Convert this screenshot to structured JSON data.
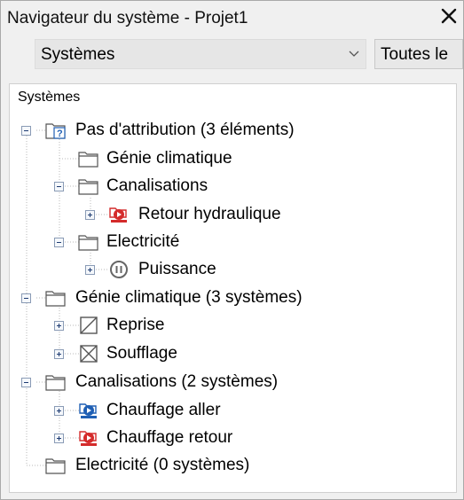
{
  "window": {
    "title": "Navigateur du système - Projet1"
  },
  "toolbar": {
    "view_select_value": "Systèmes",
    "all_button_label": "Toutes le"
  },
  "panel": {
    "header": "Systèmes",
    "rows": [
      {
        "label": "Pas d'attribution (3 éléments)",
        "icon": "unassigned-folder-icon"
      },
      {
        "label": "Génie climatique",
        "icon": "folder-icon"
      },
      {
        "label": "Canalisations",
        "icon": "folder-icon"
      },
      {
        "label": "Retour hydraulique",
        "icon": "hydronic-return-icon"
      },
      {
        "label": "Electricité",
        "icon": "folder-icon"
      },
      {
        "label": "Puissance",
        "icon": "power-icon"
      },
      {
        "label": "Génie climatique (3 systèmes)",
        "icon": "folder-icon"
      },
      {
        "label": "Reprise",
        "icon": "return-air-icon"
      },
      {
        "label": "Soufflage",
        "icon": "supply-air-icon"
      },
      {
        "label": "Canalisations (2 systèmes)",
        "icon": "folder-icon"
      },
      {
        "label": "Chauffage aller",
        "icon": "heating-supply-icon"
      },
      {
        "label": "Chauffage retour",
        "icon": "heating-return-icon"
      },
      {
        "label": "Electricité (0 systèmes)",
        "icon": "folder-icon"
      }
    ]
  },
  "colors": {
    "heating_supply": "#1f5fb4",
    "heating_return": "#d42b2b",
    "toggle_border": "#8a9bb5"
  }
}
